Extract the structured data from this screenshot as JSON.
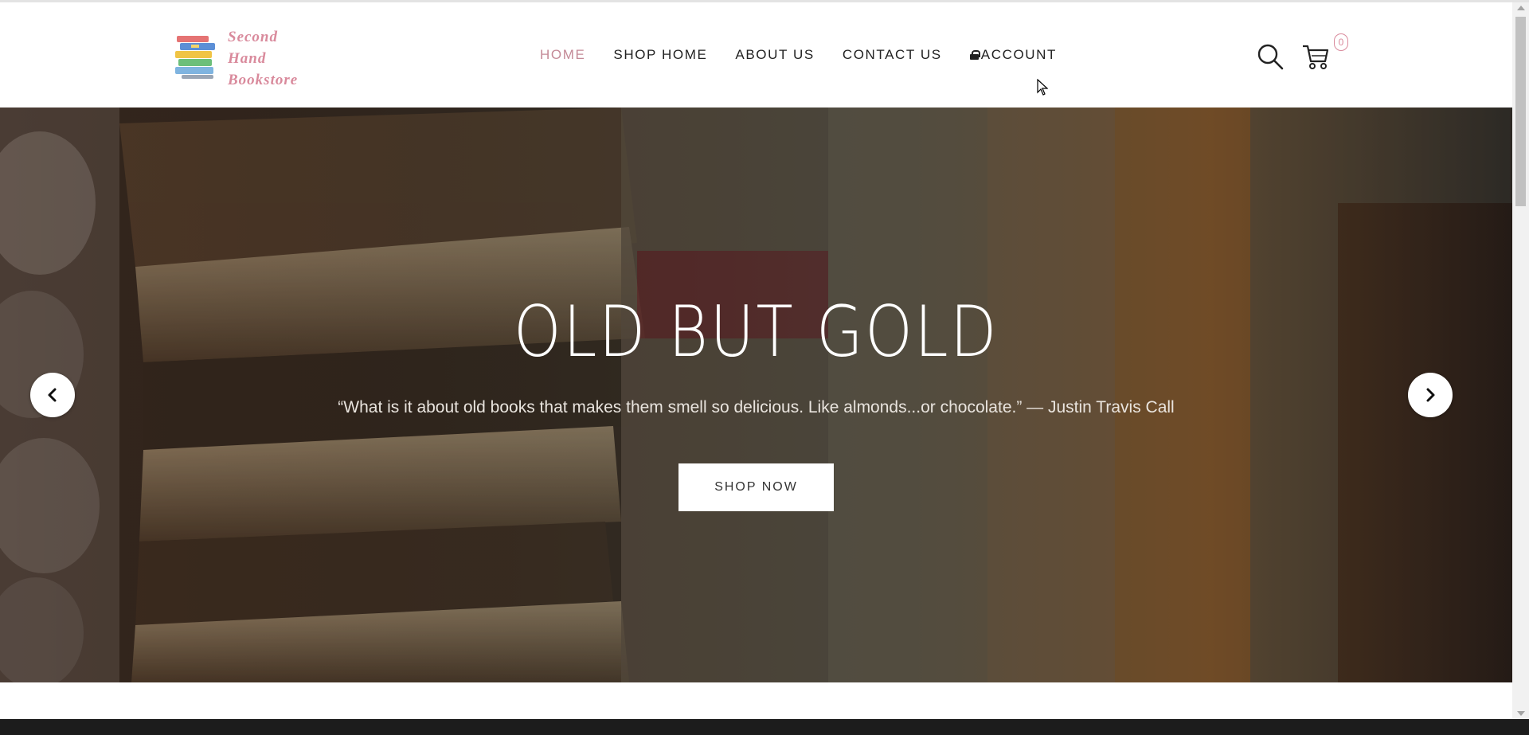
{
  "logo": {
    "lines": [
      "Second",
      "Hand",
      "Bookstore"
    ]
  },
  "nav": {
    "items": [
      {
        "label": "HOME"
      },
      {
        "label": "SHOP HOME"
      },
      {
        "label": "ABOUT US"
      },
      {
        "label": "CONTACT US"
      },
      {
        "label": "ACCOUNT"
      }
    ]
  },
  "header": {
    "cart_count": "0"
  },
  "hero": {
    "title": "OLD BUT GOLD",
    "quote": "“What is it about old books that makes them smell so delicious. Like almonds...or chocolate.” — Justin Travis Call",
    "cta": "SHOP NOW"
  },
  "colors": {
    "accent": "#c48a97",
    "text": "#222222",
    "button_bg": "#ffffff"
  },
  "icons": {
    "search": "search-icon",
    "cart": "cart-icon",
    "lock": "lock-icon",
    "prev": "chevron-left-icon",
    "next": "chevron-right-icon"
  }
}
